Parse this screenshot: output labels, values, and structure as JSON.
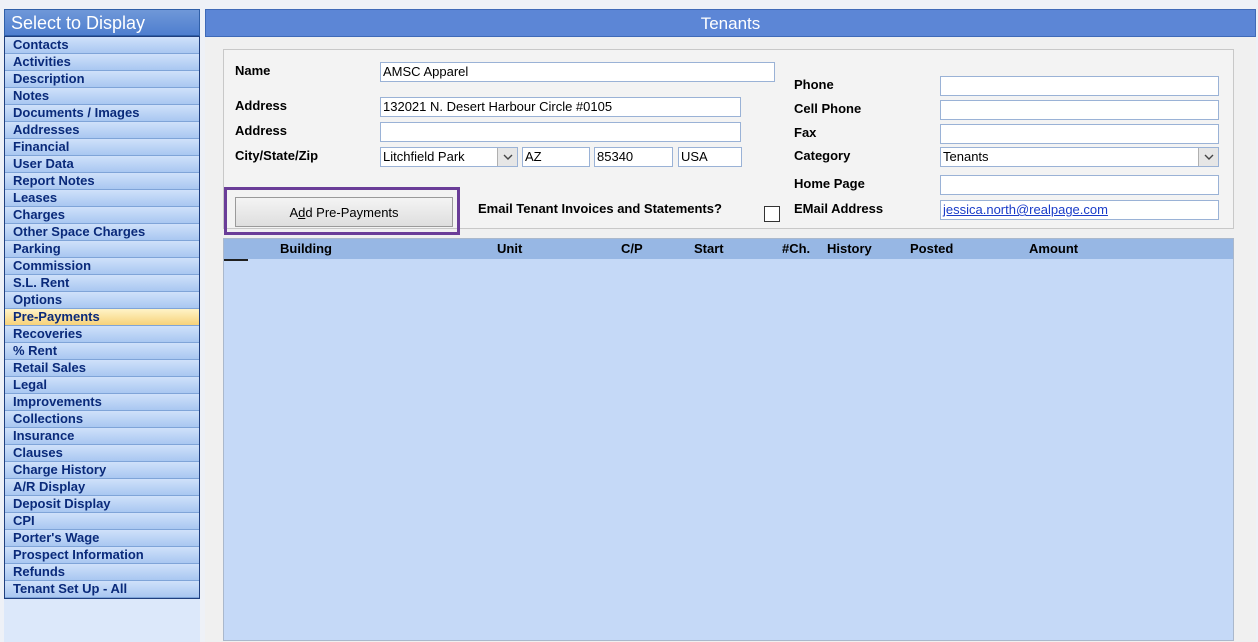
{
  "sidebar": {
    "title": "Select to Display",
    "items": [
      {
        "label": "Contacts"
      },
      {
        "label": "Activities"
      },
      {
        "label": "Description"
      },
      {
        "label": "Notes"
      },
      {
        "label": "Documents / Images"
      },
      {
        "label": "Addresses"
      },
      {
        "label": "Financial"
      },
      {
        "label": "User Data"
      },
      {
        "label": "Report Notes"
      },
      {
        "label": "Leases"
      },
      {
        "label": "Charges"
      },
      {
        "label": "Other Space Charges"
      },
      {
        "label": "Parking"
      },
      {
        "label": "Commission"
      },
      {
        "label": "S.L. Rent"
      },
      {
        "label": "Options"
      },
      {
        "label": "Pre-Payments",
        "active": true
      },
      {
        "label": "Recoveries"
      },
      {
        "label": "% Rent"
      },
      {
        "label": "Retail Sales"
      },
      {
        "label": "Legal"
      },
      {
        "label": "Improvements"
      },
      {
        "label": "Collections"
      },
      {
        "label": "Insurance"
      },
      {
        "label": "Clauses"
      },
      {
        "label": "Charge History"
      },
      {
        "label": "A/R Display"
      },
      {
        "label": "Deposit Display"
      },
      {
        "label": "CPI"
      },
      {
        "label": "Porter's Wage"
      },
      {
        "label": "Prospect Information"
      },
      {
        "label": "Refunds"
      },
      {
        "label": "Tenant Set Up - All"
      }
    ]
  },
  "main": {
    "title": "Tenants"
  },
  "form": {
    "name_label": "Name",
    "name_value": "AMSC Apparel",
    "address1_label": "Address",
    "address1_value": "132021 N. Desert Harbour Circle  #0105",
    "address2_label": "Address",
    "address2_value": "",
    "csz_label": "City/State/Zip",
    "city_value": "Litchfield Park",
    "state_value": "AZ",
    "zip_value": "85340",
    "country_value": "USA",
    "phone_label": "Phone",
    "phone_value": "",
    "cell_label": "Cell Phone",
    "cell_value": "",
    "fax_label": "Fax",
    "fax_value": "",
    "category_label": "Category",
    "category_value": "Tenants",
    "homepage_label": "Home Page",
    "homepage_value": "",
    "email_label": "EMail Address",
    "email_value": "jessica.north@realpage.com",
    "email_invoices_label": "Email Tenant Invoices and Statements?",
    "email_invoices_checked": false,
    "add_prepayments_label": "Add Pre-Payments"
  },
  "grid": {
    "columns": [
      "Building",
      "Unit",
      "C/P",
      "Start",
      "#Ch.",
      "History",
      "Posted",
      "Amount"
    ],
    "rows": []
  },
  "icons": {
    "dropdown": "chevron-down-icon"
  },
  "colors": {
    "header_blue": "#5c86d6",
    "sidebar_item": "#a9c7f1",
    "active_item": "#f7d27a",
    "grid_bg": "#c5d9f7",
    "highlight_outline": "#6a3d98"
  }
}
